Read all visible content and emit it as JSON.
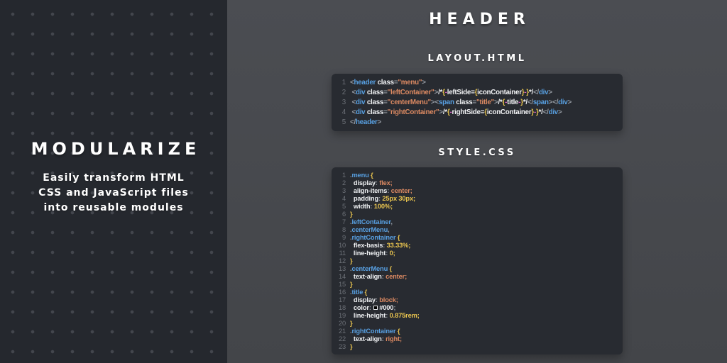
{
  "colors": {
    "left-bg": "#25282e",
    "dot": "#43464d",
    "right-bg-top": "#4b4d52",
    "right-bg-bottom": "#434549",
    "code-bg": "#282b31",
    "white": "#ffffff",
    "ln": "#6d7178",
    "plain": "#c9ccd1",
    "pun": "#9298a0",
    "tag": "#58a0e2",
    "attr": "#eef0f2",
    "str": "#dd8a62",
    "num": "#eac54f",
    "dash": "#d563c2",
    "tpl": "#f2f3f5"
  },
  "left_panel": {
    "title": "MODULARIZE",
    "subtitle_lines": [
      "Easily transform HTML",
      "CSS and JavaScript files",
      "into reusable modules"
    ]
  },
  "right_panel": {
    "title": "HEADER",
    "files": [
      {
        "name": "LAYOUT.HTML",
        "language": "html",
        "lines": [
          [
            [
              "pun",
              "<"
            ],
            [
              "tag",
              "header"
            ],
            [
              "plain",
              " "
            ],
            [
              "attr",
              "class"
            ],
            [
              "pun",
              "="
            ],
            [
              "str",
              "\"menu\""
            ],
            [
              "pun",
              ">"
            ]
          ],
          [
            [
              "plain",
              " "
            ],
            [
              "pun",
              "<"
            ],
            [
              "tag",
              "div"
            ],
            [
              "plain",
              " "
            ],
            [
              "attr",
              "class"
            ],
            [
              "pun",
              "="
            ],
            [
              "str",
              "\"leftContainer\""
            ],
            [
              "pun",
              ">"
            ],
            [
              "tpl",
              "/*"
            ],
            [
              "brace",
              "{"
            ],
            [
              "dash",
              "-"
            ],
            [
              "tpl",
              "leftSide="
            ],
            [
              "brace",
              "{"
            ],
            [
              "tpl",
              "iconContainer"
            ],
            [
              "brace",
              "}"
            ],
            [
              "dash",
              "-"
            ],
            [
              "brace",
              "}"
            ],
            [
              "tpl",
              "*/"
            ],
            [
              "pun",
              "</"
            ],
            [
              "tag",
              "div"
            ],
            [
              "pun",
              ">"
            ]
          ],
          [
            [
              "plain",
              " "
            ],
            [
              "pun",
              "<"
            ],
            [
              "tag",
              "div"
            ],
            [
              "plain",
              " "
            ],
            [
              "attr",
              "class"
            ],
            [
              "pun",
              "="
            ],
            [
              "str",
              "\"centerMenu\""
            ],
            [
              "pun",
              ">"
            ],
            [
              "pun",
              "<"
            ],
            [
              "tag",
              "span"
            ],
            [
              "plain",
              " "
            ],
            [
              "attr",
              "class"
            ],
            [
              "pun",
              "="
            ],
            [
              "str",
              "\"title\""
            ],
            [
              "pun",
              ">"
            ],
            [
              "tpl",
              "/*"
            ],
            [
              "brace",
              "{"
            ],
            [
              "dash",
              "-"
            ],
            [
              "tpl",
              "title"
            ],
            [
              "dash",
              "-"
            ],
            [
              "brace",
              "}"
            ],
            [
              "tpl",
              "*/"
            ],
            [
              "pun",
              "</"
            ],
            [
              "tag",
              "span"
            ],
            [
              "pun",
              ">"
            ],
            [
              "pun",
              "</"
            ],
            [
              "tag",
              "div"
            ],
            [
              "pun",
              ">"
            ]
          ],
          [
            [
              "plain",
              " "
            ],
            [
              "pun",
              "<"
            ],
            [
              "tag",
              "div"
            ],
            [
              "plain",
              " "
            ],
            [
              "attr",
              "class"
            ],
            [
              "pun",
              "="
            ],
            [
              "str",
              "\"rightContainer\""
            ],
            [
              "pun",
              ">"
            ],
            [
              "tpl",
              "/*"
            ],
            [
              "brace",
              "{"
            ],
            [
              "dash",
              "-"
            ],
            [
              "tpl",
              "rightSide="
            ],
            [
              "brace",
              "{"
            ],
            [
              "tpl",
              "iconContainer"
            ],
            [
              "brace",
              "}"
            ],
            [
              "dash",
              "-"
            ],
            [
              "brace",
              "}"
            ],
            [
              "tpl",
              "*/"
            ],
            [
              "pun",
              "</"
            ],
            [
              "tag",
              "div"
            ],
            [
              "pun",
              ">"
            ]
          ],
          [
            [
              "pun",
              "</"
            ],
            [
              "tag",
              "header"
            ],
            [
              "pun",
              ">"
            ]
          ]
        ]
      },
      {
        "name": "STYLE.CSS",
        "language": "css",
        "lines": [
          [
            [
              "pun",
              "."
            ],
            [
              "tag",
              "menu"
            ],
            [
              "plain",
              " "
            ],
            [
              "brace",
              "{"
            ]
          ],
          [
            [
              "plain",
              "  "
            ],
            [
              "attr",
              "display"
            ],
            [
              "pun",
              ":"
            ],
            [
              "str",
              " flex;"
            ]
          ],
          [
            [
              "plain",
              "  "
            ],
            [
              "attr",
              "align-items"
            ],
            [
              "pun",
              ":"
            ],
            [
              "str",
              " center;"
            ]
          ],
          [
            [
              "plain",
              "  "
            ],
            [
              "attr",
              "padding"
            ],
            [
              "pun",
              ":"
            ],
            [
              "num",
              " 25px 30px;"
            ]
          ],
          [
            [
              "plain",
              "  "
            ],
            [
              "attr",
              "width"
            ],
            [
              "pun",
              ":"
            ],
            [
              "num",
              " 100%;"
            ]
          ],
          [
            [
              "brace",
              "}"
            ]
          ],
          [
            [
              "pun",
              "."
            ],
            [
              "tag",
              "leftContainer"
            ],
            [
              "pun",
              ","
            ]
          ],
          [
            [
              "pun",
              "."
            ],
            [
              "tag",
              "centerMenu"
            ],
            [
              "pun",
              ","
            ]
          ],
          [
            [
              "pun",
              "."
            ],
            [
              "tag",
              "rightContainer"
            ],
            [
              "plain",
              " "
            ],
            [
              "brace",
              "{"
            ]
          ],
          [
            [
              "plain",
              "  "
            ],
            [
              "attr",
              "flex-basis"
            ],
            [
              "pun",
              ":"
            ],
            [
              "num",
              " 33.33%;"
            ]
          ],
          [
            [
              "plain",
              "  "
            ],
            [
              "attr",
              "line-height"
            ],
            [
              "pun",
              ":"
            ],
            [
              "num",
              " 0;"
            ]
          ],
          [
            [
              "brace",
              "}"
            ]
          ],
          [
            [
              "pun",
              "."
            ],
            [
              "tag",
              "centerMenu"
            ],
            [
              "plain",
              " "
            ],
            [
              "brace",
              "{"
            ]
          ],
          [
            [
              "plain",
              "  "
            ],
            [
              "attr",
              "text-align"
            ],
            [
              "pun",
              ":"
            ],
            [
              "str",
              " center;"
            ]
          ],
          [
            [
              "brace",
              "}"
            ]
          ],
          [
            [
              "pun",
              "."
            ],
            [
              "tag",
              "title"
            ],
            [
              "plain",
              " "
            ],
            [
              "brace",
              "{"
            ]
          ],
          [
            [
              "plain",
              "  "
            ],
            [
              "attr",
              "display"
            ],
            [
              "pun",
              ":"
            ],
            [
              "str",
              " block;"
            ]
          ],
          [
            [
              "plain",
              "  "
            ],
            [
              "attr",
              "color"
            ],
            [
              "pun",
              ":"
            ],
            [
              "plain",
              " "
            ],
            [
              "swatch",
              ""
            ],
            [
              "tpl",
              "#000"
            ],
            [
              "pun",
              ";"
            ]
          ],
          [
            [
              "plain",
              "  "
            ],
            [
              "attr",
              "line-height"
            ],
            [
              "pun",
              ":"
            ],
            [
              "num",
              " 0.875rem;"
            ]
          ],
          [
            [
              "brace",
              "}"
            ]
          ],
          [
            [
              "pun",
              "."
            ],
            [
              "tag",
              "rightContainer"
            ],
            [
              "plain",
              " "
            ],
            [
              "brace",
              "{"
            ]
          ],
          [
            [
              "plain",
              "  "
            ],
            [
              "attr",
              "text-align"
            ],
            [
              "pun",
              ":"
            ],
            [
              "str",
              " right;"
            ]
          ],
          [
            [
              "brace",
              "}"
            ]
          ]
        ]
      }
    ]
  }
}
